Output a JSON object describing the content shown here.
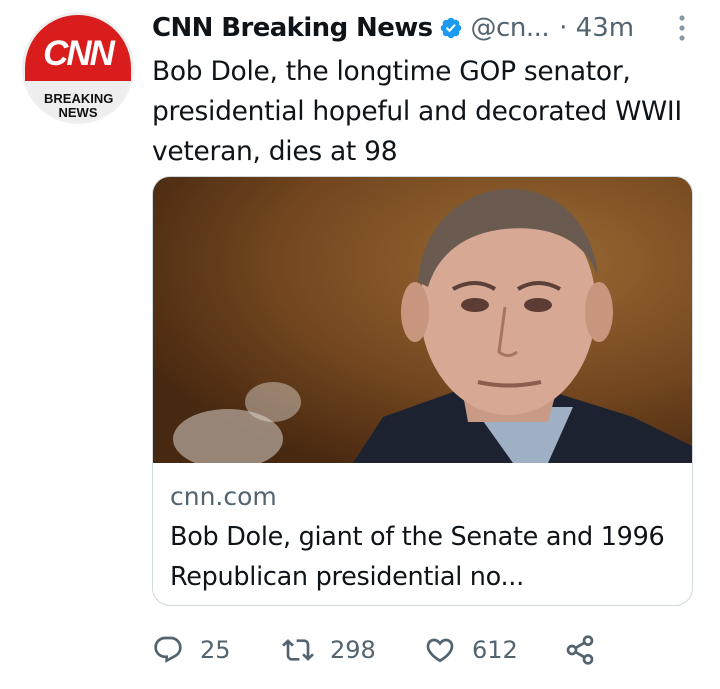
{
  "tweet": {
    "avatar": {
      "logo": "CNN",
      "sublabel": "BREAKING NEWS",
      "icon": "cnn-logo-icon"
    },
    "author_name": "CNN Breaking News",
    "handle": "@cn...",
    "time": "· 43m",
    "verified": true,
    "more_icon": "more-vertical-icon",
    "text": "Bob Dole, the longtime GOP senator, presidential hopeful and decorated WWII veteran, dies at 98",
    "card": {
      "image_alt": "photo of Bob Dole",
      "domain": "cnn.com",
      "title": "Bob Dole, giant of the Senate and 1996 Republican presidential no..."
    },
    "actions": {
      "reply": {
        "icon": "reply-icon",
        "count": "25"
      },
      "retweet": {
        "icon": "retweet-icon",
        "count": "298"
      },
      "like": {
        "icon": "heart-icon",
        "count": "612"
      },
      "share": {
        "icon": "share-icon"
      }
    }
  },
  "colors": {
    "verified": "#1d9bf0",
    "muted": "#536471",
    "cnn_red": "#d91c1c"
  }
}
